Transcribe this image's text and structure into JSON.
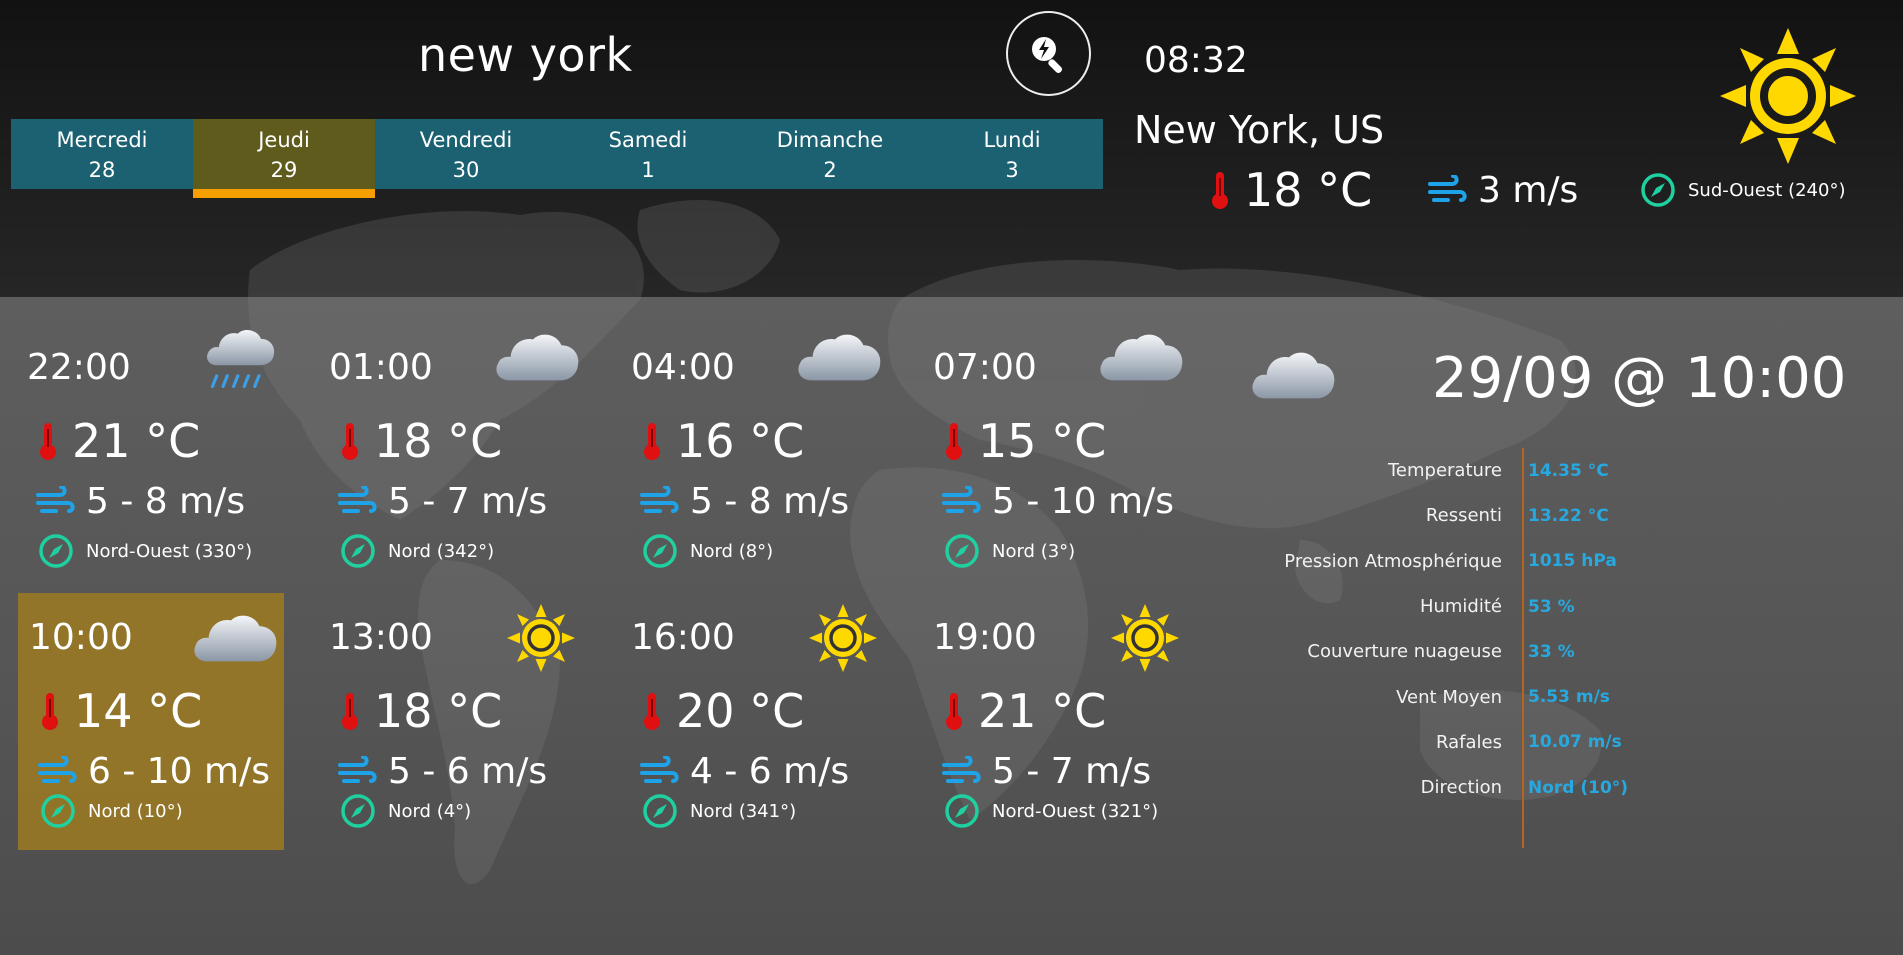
{
  "header": {
    "city_query": "new york",
    "clock": "08:32",
    "location": "New York, US",
    "current_temp": "18 °C",
    "current_wind": "3 m/s",
    "current_direction": "Sud-Ouest (240°)",
    "current_icon": "sun-icon"
  },
  "days": [
    {
      "name": "Mercredi",
      "date": "28"
    },
    {
      "name": "Jeudi",
      "date": "29"
    },
    {
      "name": "Vendredi",
      "date": "30"
    },
    {
      "name": "Samedi",
      "date": "1"
    },
    {
      "name": "Dimanche",
      "date": "2"
    },
    {
      "name": "Lundi",
      "date": "3"
    }
  ],
  "selected_day": "Jeudi",
  "slots": [
    {
      "time": "22:00",
      "icon": "rain-cloud-icon",
      "temp": "21 °C",
      "wind": "5 - 8 m/s",
      "dir": "Nord-Ouest (330°)"
    },
    {
      "time": "01:00",
      "icon": "cloud-icon",
      "temp": "18 °C",
      "wind": "5 - 7 m/s",
      "dir": "Nord (342°)"
    },
    {
      "time": "04:00",
      "icon": "cloud-icon",
      "temp": "16 °C",
      "wind": "5 - 8 m/s",
      "dir": "Nord (8°)"
    },
    {
      "time": "07:00",
      "icon": "cloud-icon",
      "temp": "15 °C",
      "wind": "5 - 10 m/s",
      "dir": "Nord (3°)"
    },
    {
      "time": "10:00",
      "icon": "cloud-icon",
      "temp": "14 °C",
      "wind": "6 - 10 m/s",
      "dir": "Nord (10°)"
    },
    {
      "time": "13:00",
      "icon": "sun-icon",
      "temp": "18 °C",
      "wind": "5 - 6 m/s",
      "dir": "Nord (4°)"
    },
    {
      "time": "16:00",
      "icon": "sun-icon",
      "temp": "20 °C",
      "wind": "4 - 6 m/s",
      "dir": "Nord (341°)"
    },
    {
      "time": "19:00",
      "icon": "sun-icon",
      "temp": "21 °C",
      "wind": "5 - 7 m/s",
      "dir": "Nord-Ouest (321°)"
    }
  ],
  "selected_slot": "10:00",
  "detail": {
    "title": "29/09 @ 10:00",
    "icon": "cloud-icon",
    "rows": [
      {
        "label": "Temperature",
        "value": "14.35 °C"
      },
      {
        "label": "Ressenti",
        "value": "13.22 °C"
      },
      {
        "label": "Pression Atmosphérique",
        "value": "1015 hPa"
      },
      {
        "label": "Humidité",
        "value": "53 %"
      },
      {
        "label": "Couverture nuageuse",
        "value": "33 %"
      },
      {
        "label": "Vent Moyen",
        "value": "5.53 m/s"
      },
      {
        "label": "Rafales",
        "value": "10.07 m/s"
      },
      {
        "label": "Direction",
        "value": "Nord (10°)"
      }
    ]
  },
  "colors": {
    "tab": "#1b6172",
    "tab_active": "#5e5b1c",
    "tab_underline": "#f5a000",
    "slot_active": "#a07d1e",
    "thermometer": "#e01010",
    "wind": "#1fa3e8",
    "compass": "#1fd0a0",
    "value": "#27a9e0",
    "separator": "#b5651d"
  }
}
